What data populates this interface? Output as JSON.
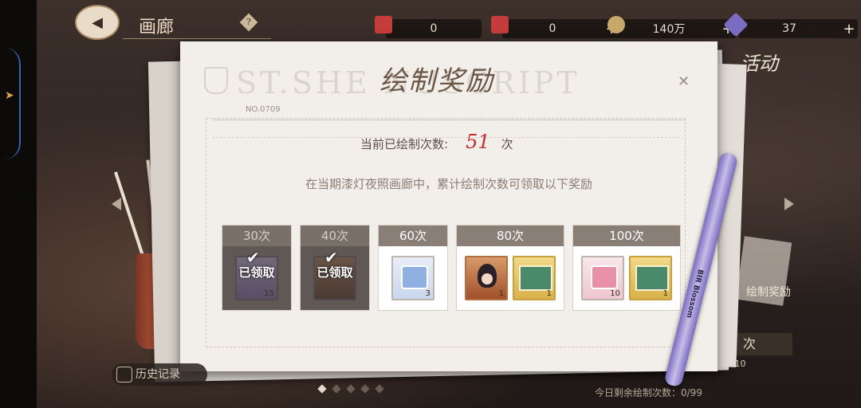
{
  "header": {
    "title": "画廊",
    "help_icon": "?",
    "currencies": [
      {
        "name": "paint-ticket-a",
        "value": "0",
        "color": "#c43c3c"
      },
      {
        "name": "paint-ticket-b",
        "value": "0",
        "color": "#c43c3c"
      },
      {
        "name": "coin",
        "value": "140万",
        "color": "#c8a868"
      },
      {
        "name": "gem",
        "value": "37",
        "color": "#7a6cc0"
      }
    ],
    "plus": "+"
  },
  "side": {
    "activity_label": "活动",
    "draw_reward_label": "绘制奖励",
    "ci_badge": "次",
    "x10": "X10"
  },
  "dialog": {
    "title": "绘制奖励",
    "watermark": "ST.SHE    NUSCRIPT",
    "serial": "NO.0709",
    "close_icon": "close",
    "count_label": "当前已绘制次数:",
    "count_value": "51",
    "count_unit": "次",
    "description": "在当期漆灯夜照画廊中，累计绘制次数可领取以下奖励",
    "tiers": [
      {
        "label": "30次",
        "claimed": true,
        "claimed_text": "已领取",
        "items": [
          {
            "type": "purple",
            "qty": "15"
          }
        ]
      },
      {
        "label": "40次",
        "claimed": true,
        "claimed_text": "已领取",
        "items": [
          {
            "type": "brown",
            "qty": ""
          }
        ]
      },
      {
        "label": "60次",
        "claimed": false,
        "items": [
          {
            "type": "gift-blue",
            "qty": "3"
          }
        ]
      },
      {
        "label": "80次",
        "claimed": false,
        "items": [
          {
            "type": "portrait",
            "qty": "1"
          },
          {
            "type": "scene",
            "qty": "1"
          }
        ]
      },
      {
        "label": "100次",
        "claimed": false,
        "items": [
          {
            "type": "gift-pink",
            "qty": "10"
          },
          {
            "type": "scene",
            "qty": "1"
          }
        ]
      }
    ]
  },
  "footer": {
    "history_label": "历史记录",
    "today_text": "今日剩余绘制次数：0/99",
    "page_count": 5,
    "active_page": 0
  },
  "pen_label": "BIR Blossom"
}
